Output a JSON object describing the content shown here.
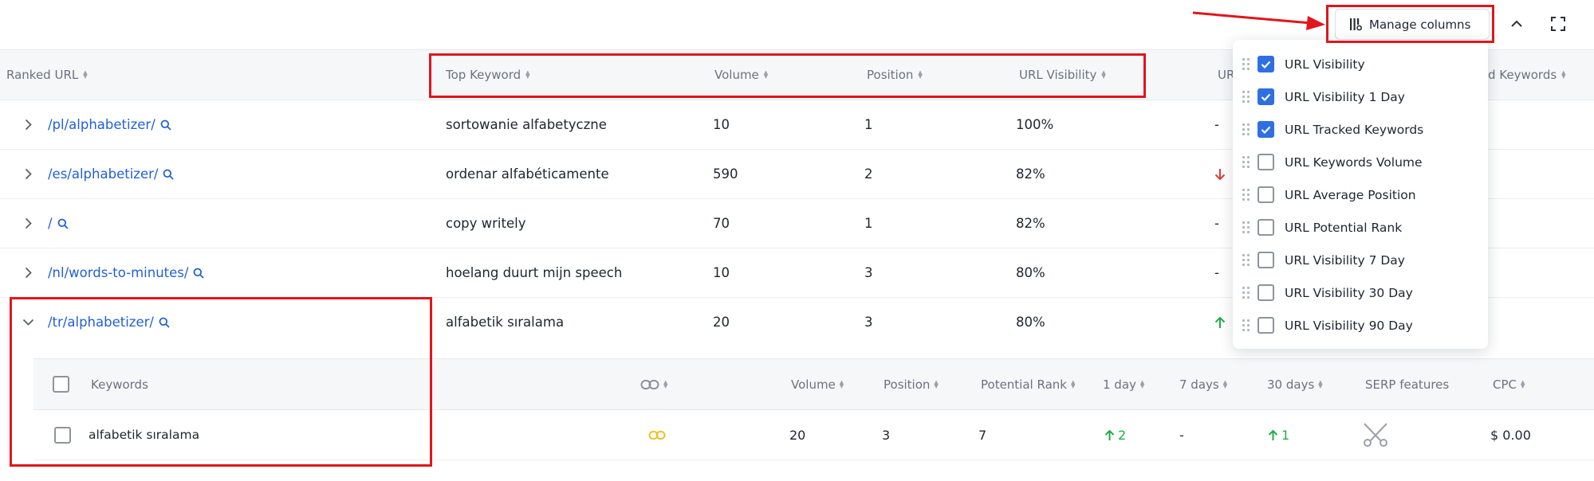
{
  "toolbar": {
    "manage_columns_label": "Manage columns"
  },
  "table": {
    "headers": [
      "Ranked URL",
      "Top Keyword",
      "Volume",
      "Position",
      "URL Visibility",
      "UR",
      "d Keywords"
    ],
    "rows": [
      {
        "url": "/pl/alphabetizer/",
        "keyword": "sortowanie alfabetyczne",
        "volume": "10",
        "position": "1",
        "visibility": "100%",
        "trend": "-",
        "expanded": false
      },
      {
        "url": "/es/alphabetizer/",
        "keyword": "ordenar alfabéticamente",
        "volume": "590",
        "position": "2",
        "visibility": "82%",
        "trend": "down",
        "expanded": false
      },
      {
        "url": "/",
        "keyword": "copy writely",
        "volume": "70",
        "position": "1",
        "visibility": "82%",
        "trend": "-",
        "expanded": false
      },
      {
        "url": "/nl/words-to-minutes/",
        "keyword": "hoelang duurt mijn speech",
        "volume": "10",
        "position": "3",
        "visibility": "80%",
        "trend": "-",
        "expanded": false
      },
      {
        "url": "/tr/alphabetizer/",
        "keyword": "alfabetik sıralama",
        "volume": "20",
        "position": "3",
        "visibility": "80%",
        "trend": "up",
        "expanded": true
      }
    ]
  },
  "subtable": {
    "headers": {
      "keywords": "Keywords",
      "volume": "Volume",
      "position": "Position",
      "potential_rank": "Potential Rank",
      "day1": "1 day",
      "day7": "7 days",
      "day30": "30 days",
      "serp": "SERP features",
      "cpc": "CPC"
    },
    "row": {
      "keyword": "alfabetik sıralama",
      "volume": "20",
      "position": "3",
      "potential_rank": "7",
      "day1": "2",
      "day7": "-",
      "day30": "1",
      "cpc": "$ 0.00"
    }
  },
  "manage_columns_menu": {
    "items": [
      {
        "label": "URL Visibility",
        "checked": true
      },
      {
        "label": "URL Visibility 1 Day",
        "checked": true
      },
      {
        "label": "URL Tracked Keywords",
        "checked": true
      },
      {
        "label": "URL Keywords Volume",
        "checked": false
      },
      {
        "label": "URL Average Position",
        "checked": false
      },
      {
        "label": "URL Potential Rank",
        "checked": false
      },
      {
        "label": "URL Visibility 7 Day",
        "checked": false
      },
      {
        "label": "URL Visibility 30 Day",
        "checked": false
      },
      {
        "label": "URL Visibility 90 Day",
        "checked": false
      }
    ]
  },
  "icons": {
    "manage": "columns-settings-icon",
    "collapse": "chevron-up-icon",
    "fullscreen": "fullscreen-icon",
    "search": "search-icon",
    "link": "link-icon",
    "serp": "scissors-icon",
    "drag": "drag-handle-icon"
  },
  "colors": {
    "link": "#2160d8",
    "check_on": "#2f6fe4",
    "highlight": "#e0161c",
    "trend_up": "#1fae4b",
    "trend_down": "#e53935",
    "link_icon_subrow": "#e9c327"
  }
}
